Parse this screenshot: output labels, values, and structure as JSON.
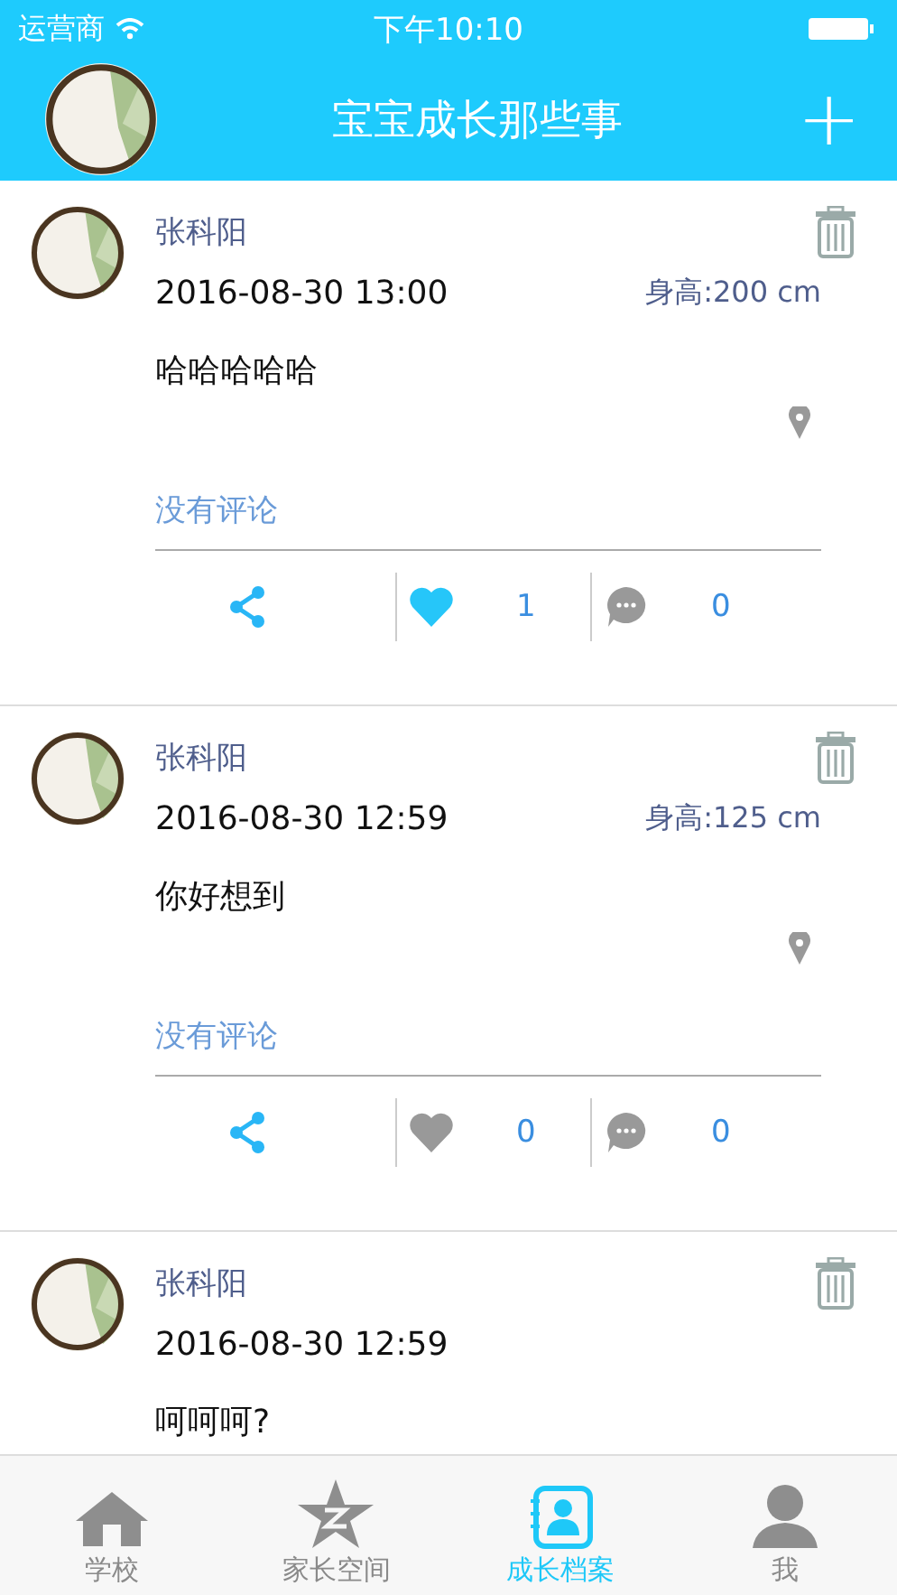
{
  "status_bar": {
    "carrier": "运营商",
    "time": "下午10:10"
  },
  "nav": {
    "title": "宝宝成长那些事",
    "add_button": "+"
  },
  "posts": [
    {
      "author": "张科阳",
      "date": "2016-08-30 13:00",
      "height": "身高:200 cm",
      "text": "哈哈哈哈哈",
      "comments_label": "没有评论",
      "liked": true,
      "likes": "1",
      "comments": "0"
    },
    {
      "author": "张科阳",
      "date": "2016-08-30 12:59",
      "height": "身高:125 cm",
      "text": "你好想到",
      "comments_label": "没有评论",
      "liked": false,
      "likes": "0",
      "comments": "0"
    },
    {
      "author": "张科阳",
      "date": "2016-08-30 12:59",
      "text": "呵呵呵?"
    }
  ],
  "tabs": [
    {
      "label": "学校",
      "kind": "home",
      "selected": false
    },
    {
      "label": "家长空间",
      "kind": "star",
      "selected": false
    },
    {
      "label": "成长档案",
      "kind": "contacts",
      "selected": true
    },
    {
      "label": "我",
      "kind": "person",
      "selected": false
    }
  ]
}
